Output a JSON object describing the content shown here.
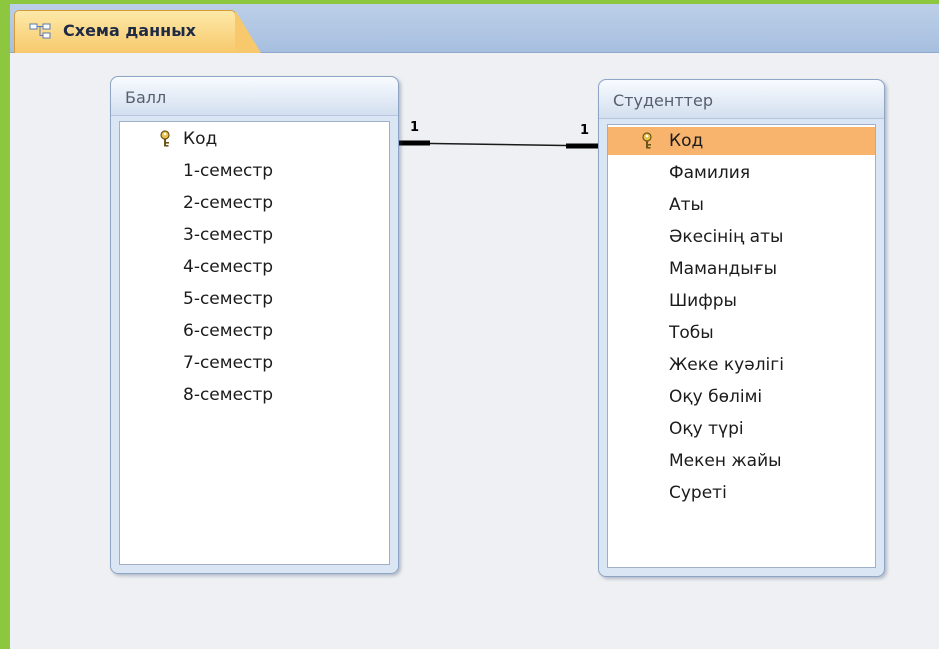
{
  "tab": {
    "label": "Схема данных",
    "icon": "relationships-icon"
  },
  "left_table": {
    "title": "Балл",
    "fields": [
      {
        "label": "Код",
        "primary_key": true
      },
      {
        "label": "1-семестр"
      },
      {
        "label": "2-семестр"
      },
      {
        "label": "3-семестр"
      },
      {
        "label": "4-семестр"
      },
      {
        "label": "5-семестр"
      },
      {
        "label": "6-семестр"
      },
      {
        "label": "7-семестр"
      },
      {
        "label": "8-семестр"
      }
    ]
  },
  "right_table": {
    "title": "Студенттер",
    "selected_field": "Код",
    "fields": [
      {
        "label": "Код",
        "primary_key": true
      },
      {
        "label": "Фамилия"
      },
      {
        "label": "Аты"
      },
      {
        "label": "Әкесінің аты"
      },
      {
        "label": "Мамандығы"
      },
      {
        "label": "Шифры"
      },
      {
        "label": "Тобы"
      },
      {
        "label": "Жеке куәлігі"
      },
      {
        "label": "Оқу бөлімі"
      },
      {
        "label": "Оқу түрі"
      },
      {
        "label": "Мекен жайы"
      },
      {
        "label": "Суреті"
      }
    ]
  },
  "relationship": {
    "left_cardinality": "1",
    "right_cardinality": "1"
  },
  "colors": {
    "outer_border": "#8dc63f",
    "tab_fill": "#f7c96c",
    "selected_row": "#f8b36d",
    "canvas": "#eef0f3"
  }
}
